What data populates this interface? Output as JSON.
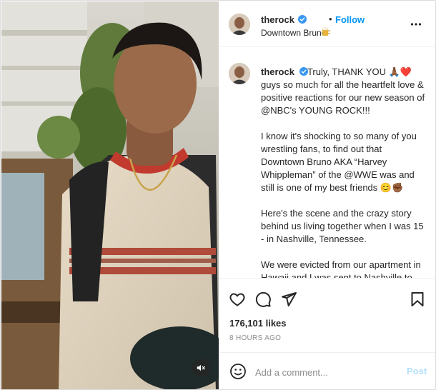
{
  "post": {
    "username": "therock",
    "follow_separator": "•",
    "follow_label": "Follow",
    "location": "Downtown Bruno",
    "more_icon": "more-horizontal-icon"
  },
  "caption": {
    "username": "therock",
    "paragraphs": [
      "Truly, THANK YOU 🙏🏾❤️ guys so much for all the heartfelt love & positive reactions for our new season of @NBC's YOUNG ROCK!!!",
      "I know it's shocking to so many of you wrestling fans, to find out that Downtown Bruno AKA “Harvey Whippleman” of the @WWE was and still is one of my best friends 😊✊🏾",
      "Here's the scene and the crazy story behind us living together when I was 15 - in Nashville, Tennessee.",
      "We were evicted from our apartment in Hawaii and I was sent to Nashville to live with my old man. Unfortunately, when I landed in Tennessee there was no place"
    ]
  },
  "actions": {
    "like_icon": "heart-icon",
    "comment_icon": "comment-icon",
    "share_icon": "share-icon",
    "save_icon": "bookmark-icon"
  },
  "stats": {
    "likes": "176,101 likes",
    "timestamp": "8 HOURS AGO"
  },
  "comment_box": {
    "placeholder": "Add a comment...",
    "post_label": "Post"
  },
  "media": {
    "mute_icon": "muted-speaker-icon"
  },
  "colors": {
    "link_blue": "#0095f6",
    "post_disabled": "#b2dffc",
    "verified_blue": "#3897f0",
    "text": "#262626",
    "muted": "#8e8e8e"
  }
}
